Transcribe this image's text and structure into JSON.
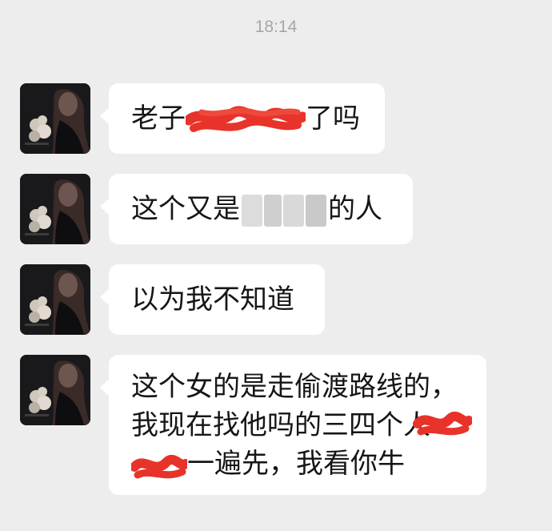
{
  "timestamp": "18:14",
  "colors": {
    "background": "#ededed",
    "bubble": "#ffffff",
    "text": "#161616",
    "timestamp": "#a6a6a6",
    "redaction": "#e8332a"
  },
  "messages": [
    {
      "avatar_icon": "profile-photo-avatar",
      "segments": [
        {
          "type": "text",
          "text": "老子"
        },
        {
          "type": "redact_red"
        },
        {
          "type": "text",
          "text": "了吗"
        }
      ]
    },
    {
      "avatar_icon": "profile-photo-avatar",
      "segments": [
        {
          "type": "text",
          "text": "这个又是"
        },
        {
          "type": "redact_blur"
        },
        {
          "type": "text",
          "text": "的人"
        }
      ]
    },
    {
      "avatar_icon": "profile-photo-avatar",
      "segments": [
        {
          "type": "text",
          "text": "以为我不知道"
        }
      ]
    },
    {
      "avatar_icon": "profile-photo-avatar",
      "lines": [
        "这个女的是走偷渡路线的，",
        "我现在找他吗的三四个人",
        "一遍先，我看你牛"
      ]
    }
  ]
}
